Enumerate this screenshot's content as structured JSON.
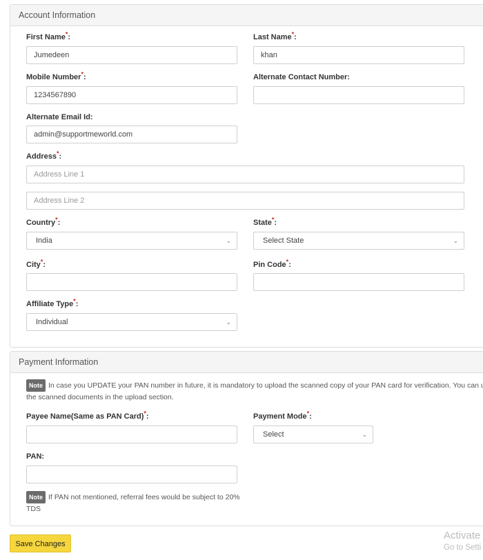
{
  "account": {
    "title": "Account Information",
    "first_name": {
      "label": "First Name",
      "value": "Jumedeen"
    },
    "last_name": {
      "label": "Last Name",
      "value": "khan"
    },
    "mobile": {
      "label": "Mobile Number",
      "value": "1234567890"
    },
    "alt_contact": {
      "label": "Alternate Contact Number:",
      "value": ""
    },
    "alt_email": {
      "label": "Alternate Email Id:",
      "value": "admin@supportmeworld.com"
    },
    "address": {
      "label": "Address",
      "line1_placeholder": "Address Line 1",
      "line2_placeholder": "Address Line 2"
    },
    "country": {
      "label": "Country",
      "value": "India"
    },
    "state": {
      "label": "State",
      "value": "Select State"
    },
    "city": {
      "label": "City",
      "value": ""
    },
    "pin": {
      "label": "Pin Code",
      "value": ""
    },
    "affiliate": {
      "label": "Affiliate Type",
      "value": "Individual"
    }
  },
  "payment": {
    "title": "Payment Information",
    "note_badge": "Note",
    "note_text": "In case you UPDATE your PAN number in future, it is mandatory to upload the scanned copy of your PAN card for verification. You can upload the scanned documents in the upload section.",
    "payee": {
      "label": "Payee Name(Same as PAN Card)",
      "value": ""
    },
    "mode": {
      "label": "Payment Mode",
      "value": "Select"
    },
    "pan": {
      "label": "PAN:",
      "value": ""
    },
    "pan_note": "If PAN not mentioned, referral fees would be subject to 20% TDS"
  },
  "save_label": "Save Changes",
  "watermark": {
    "line1": "Activate",
    "line2": "Go to Setti"
  },
  "colon": ":",
  "star": "*",
  "chevron": "⌄"
}
